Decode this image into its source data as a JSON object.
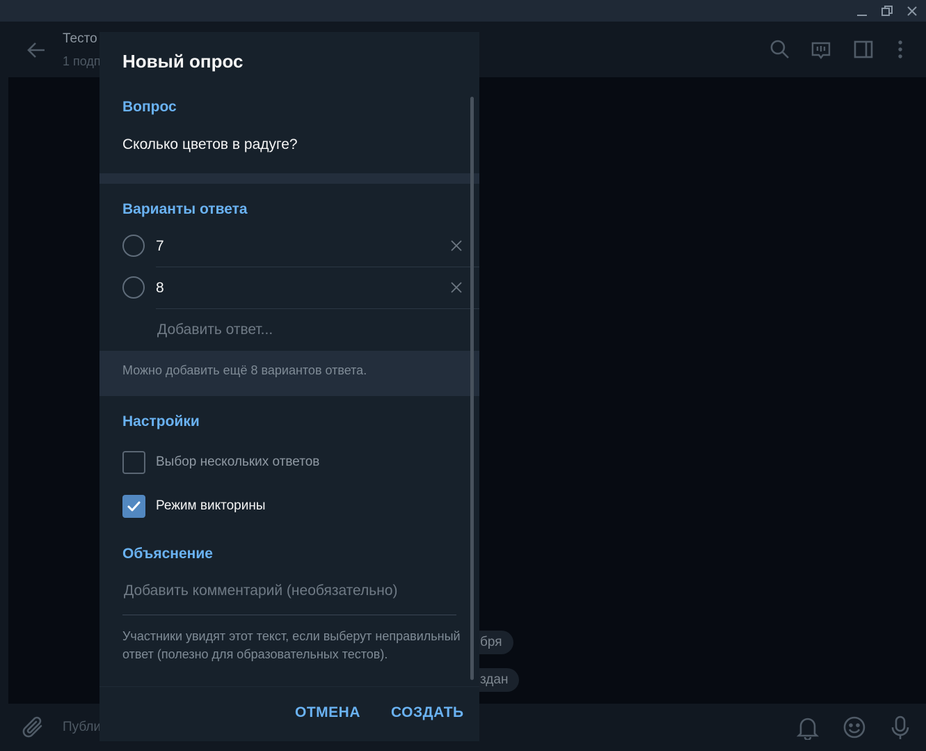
{
  "background_app": {
    "chat_title": "Тесто",
    "chat_subtitle": "1 подп",
    "compose_placeholder": "Публи",
    "service_pills": [
      "бря",
      "здан"
    ]
  },
  "dialog": {
    "title": "Новый опрос",
    "question": {
      "section_label": "Вопрос",
      "value": "Сколько цветов в радуге?"
    },
    "answers": {
      "section_label": "Варианты ответа",
      "options": [
        {
          "value": "7"
        },
        {
          "value": "8"
        }
      ],
      "add_placeholder": "Добавить ответ...",
      "hint": "Можно добавить ещё 8 вариантов ответа."
    },
    "settings": {
      "section_label": "Настройки",
      "multiple_answers": {
        "label": "Выбор нескольких ответов",
        "checked": false
      },
      "quiz_mode": {
        "label": "Режим викторины",
        "checked": true
      }
    },
    "explanation": {
      "section_label": "Объяснение",
      "placeholder": "Добавить комментарий (необязательно)",
      "hint": "Участники увидят этот текст, если выберут неправильный ответ (полезно для образовательных тестов)."
    },
    "buttons": {
      "cancel": "ОТМЕНА",
      "create": "СОЗДАТЬ"
    }
  },
  "colors": {
    "accent": "#6ab2f2",
    "checkbox_checked": "#5288c1",
    "dialog_bg": "#17212b",
    "overlay_bg": "#070b12"
  }
}
